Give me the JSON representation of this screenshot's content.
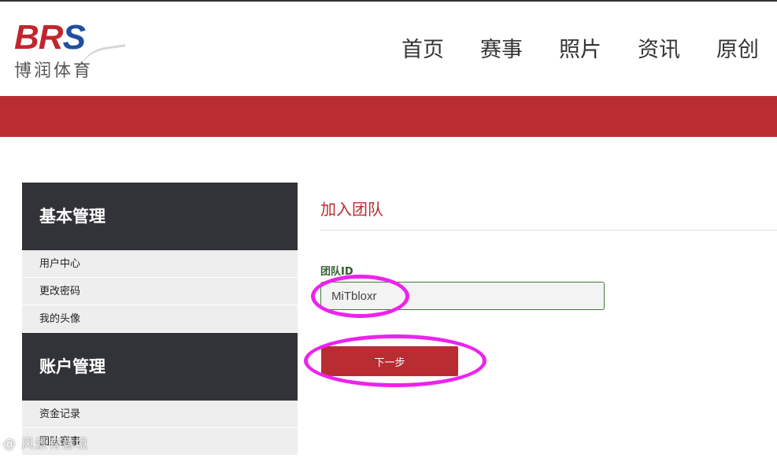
{
  "header": {
    "logo_brand": "BRS",
    "logo_subtitle": "博润体育",
    "nav": [
      "首页",
      "赛事",
      "照片",
      "资讯",
      "原创"
    ]
  },
  "colors": {
    "brand_red": "#b92d32",
    "sidebar_dark": "#323338",
    "logo_blue": "#1f4fa0",
    "input_border": "#3f7a37",
    "annotation": "#ee22ee"
  },
  "sidebar": {
    "sections": [
      {
        "title": "基本管理",
        "items": [
          "用户中心",
          "更改密码",
          "我的头像"
        ]
      },
      {
        "title": "账户管理",
        "items": [
          "资金记录",
          "团队赛事"
        ]
      }
    ]
  },
  "main": {
    "title": "加入团队",
    "field_label": "团队ID",
    "team_id_value": "MiTbloxr",
    "next_button": "下一步"
  },
  "watermark": "@ 风景有意境"
}
